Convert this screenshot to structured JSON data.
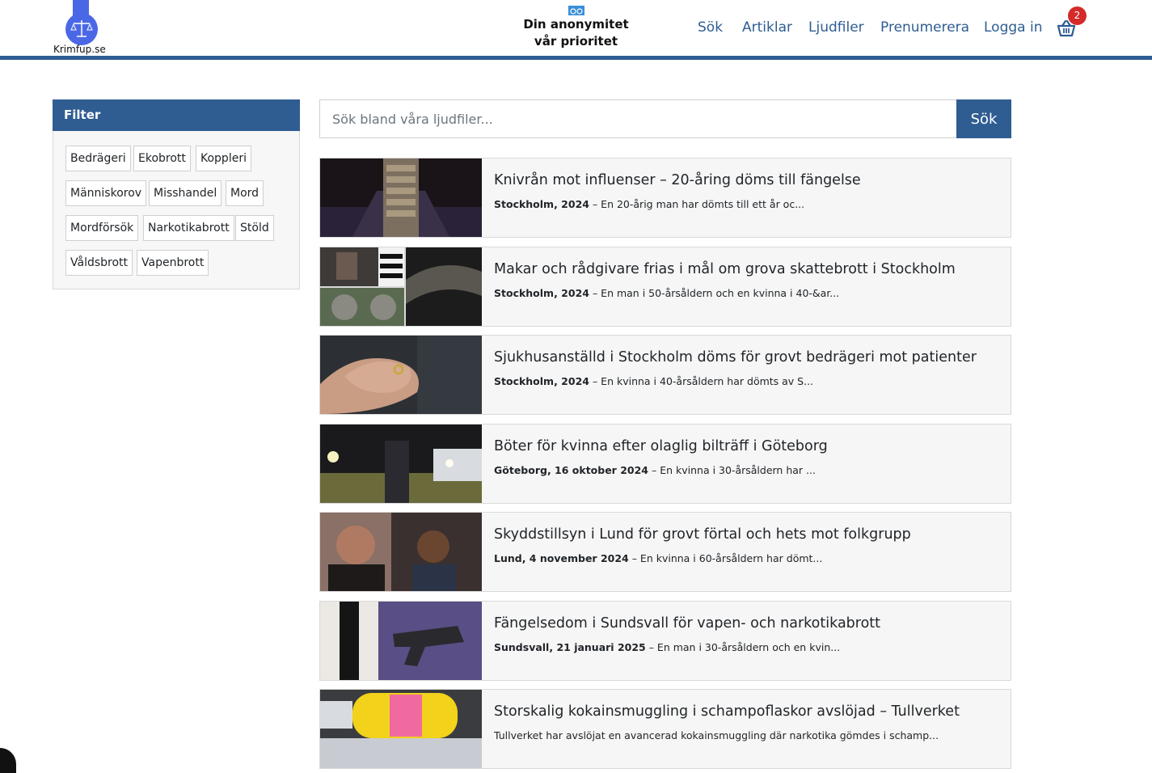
{
  "header": {
    "logo_text": "Krimfup.se",
    "slogan_line1": "Din anonymitet",
    "slogan_line2": "vår prioritet",
    "nav": [
      "Sök",
      "Artiklar",
      "Ljudfiler",
      "Prenumerera",
      "Logga in"
    ],
    "cart_count": "2",
    "brand_color": "#2f5d92"
  },
  "filter": {
    "title": "Filter",
    "tags": [
      "Bedrägeri",
      "Ekobrott",
      "Koppleri",
      "Människorov",
      "Misshandel",
      "Mord",
      "Mordförsök",
      "Narkotikabrott",
      "Stöld",
      "Våldsbrott",
      "Vapenbrott"
    ]
  },
  "search": {
    "placeholder": "Sök bland våra ljudfiler...",
    "button": "Sök"
  },
  "articles": [
    {
      "title": "Knivrån mot influenser – 20-åring döms till fängelse",
      "place": "Stockholm, 2024",
      "summary": " – En 20-årig man har dömts till ett år oc..."
    },
    {
      "title": "Makar och rådgivare frias i mål om grova skattebrott i Stockholm",
      "place": "Stockholm, 2024",
      "summary": " – En man i 50-årsåldern och en kvinna i 40-&ar..."
    },
    {
      "title": "Sjukhusanställd i Stockholm döms för grovt bedrägeri mot patienter",
      "place": "Stockholm, 2024",
      "summary": " – En kvinna i 40-årsåldern har dömts av S..."
    },
    {
      "title": "Böter för kvinna efter olaglig bilträff i Göteborg",
      "place": "Göteborg, 16 oktober 2024",
      "summary": " – En kvinna i 30-årsåldern har ..."
    },
    {
      "title": "Skyddstillsyn i Lund för grovt förtal och hets mot folkgrupp",
      "place": "Lund, 4 november 2024",
      "summary": " – En kvinna i 60-årsåldern har dömt..."
    },
    {
      "title": "Fängelsedom i Sundsvall för vapen- och narkotikabrott",
      "place": "Sundsvall, 21 januari 2025",
      "summary": " – En man i 30-årsåldern och en kvin..."
    },
    {
      "title": "Storskalig kokainsmuggling i schampoflaskor avslöjad – Tullverket",
      "place": "",
      "summary": "Tullverket har avslöjat en avancerad kokainsmuggling där narkotika gömdes i schamp..."
    }
  ]
}
